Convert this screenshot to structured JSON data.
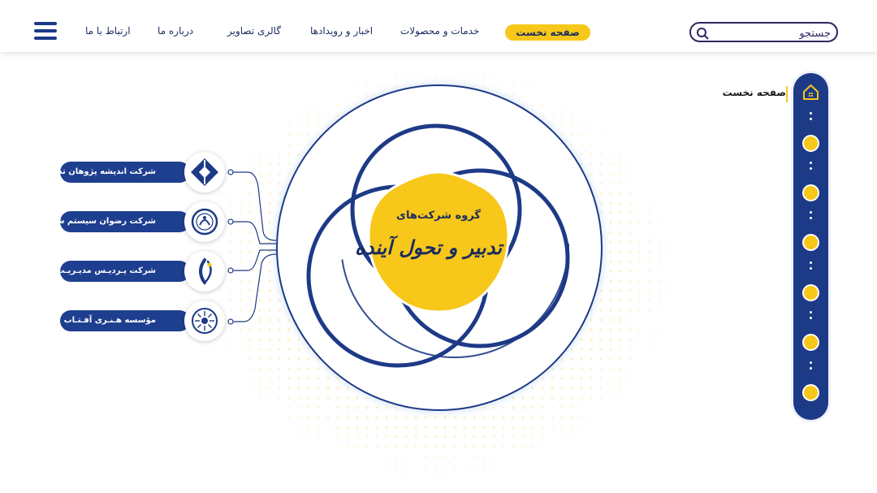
{
  "header": {
    "search_placeholder": "جستجو",
    "nav": {
      "home": "صفحه نخست",
      "services": "خدمات و محصولات",
      "news": "اخبار و رویدادها",
      "gallery": "گالری تصاویر",
      "about": "درباره ما",
      "contact": "ارتباط با ما"
    }
  },
  "center": {
    "line1": "گروه شرکت‌های",
    "line2": "تدبیر و تحول آینده"
  },
  "companies": [
    {
      "name": "شرکت اندیشه پژوهان تدبیر پایا",
      "icon": "diamond-logo-icon"
    },
    {
      "name": "شرکت رضوان سیستم شرق",
      "icon": "circle-emblem-logo-icon"
    },
    {
      "name": "شرکت پـردیـس مدیـریـت",
      "icon": "leaf-person-logo-icon"
    },
    {
      "name": "مؤسسه هـنـری آفـتـاب",
      "icon": "sun-rays-logo-icon"
    }
  ],
  "sidebar": {
    "current_label": "صفحه نخست",
    "icons": [
      "home-icon",
      "sun-icon",
      "sun-icon",
      "sun-icon",
      "sun-icon",
      "sun-icon",
      "sun-icon"
    ]
  },
  "colors": {
    "primary": "#1d3a86",
    "accent": "#f7c719",
    "text_dark": "#1a2c5e"
  }
}
